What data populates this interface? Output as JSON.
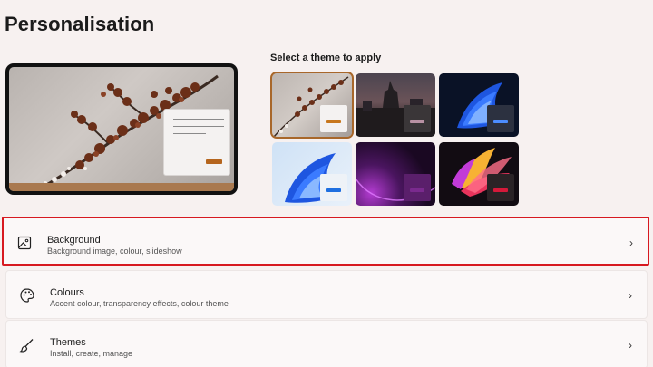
{
  "page": {
    "title": "Personalisation"
  },
  "themes": {
    "heading": "Select a theme to apply",
    "tiles": [
      {
        "id": "cherry-blossom",
        "selected": true
      },
      {
        "id": "dark-city",
        "selected": false
      },
      {
        "id": "blue-bloom-dark",
        "selected": false
      },
      {
        "id": "blue-bloom-light",
        "selected": false
      },
      {
        "id": "purple-glow",
        "selected": false
      },
      {
        "id": "colourful-flower",
        "selected": false
      }
    ]
  },
  "settings": [
    {
      "title": "Background",
      "subtitle": "Background image, colour, slideshow",
      "icon": "image-icon",
      "highlighted": true
    },
    {
      "title": "Colours",
      "subtitle": "Accent colour, transparency effects, colour theme",
      "icon": "palette-icon",
      "highlighted": false
    },
    {
      "title": "Themes",
      "subtitle": "Install, create, manage",
      "icon": "brush-icon",
      "highlighted": false
    }
  ],
  "colors": {
    "highlight": "#d71920",
    "selected_outline": "#a8672a",
    "accent": "#b5651d"
  }
}
